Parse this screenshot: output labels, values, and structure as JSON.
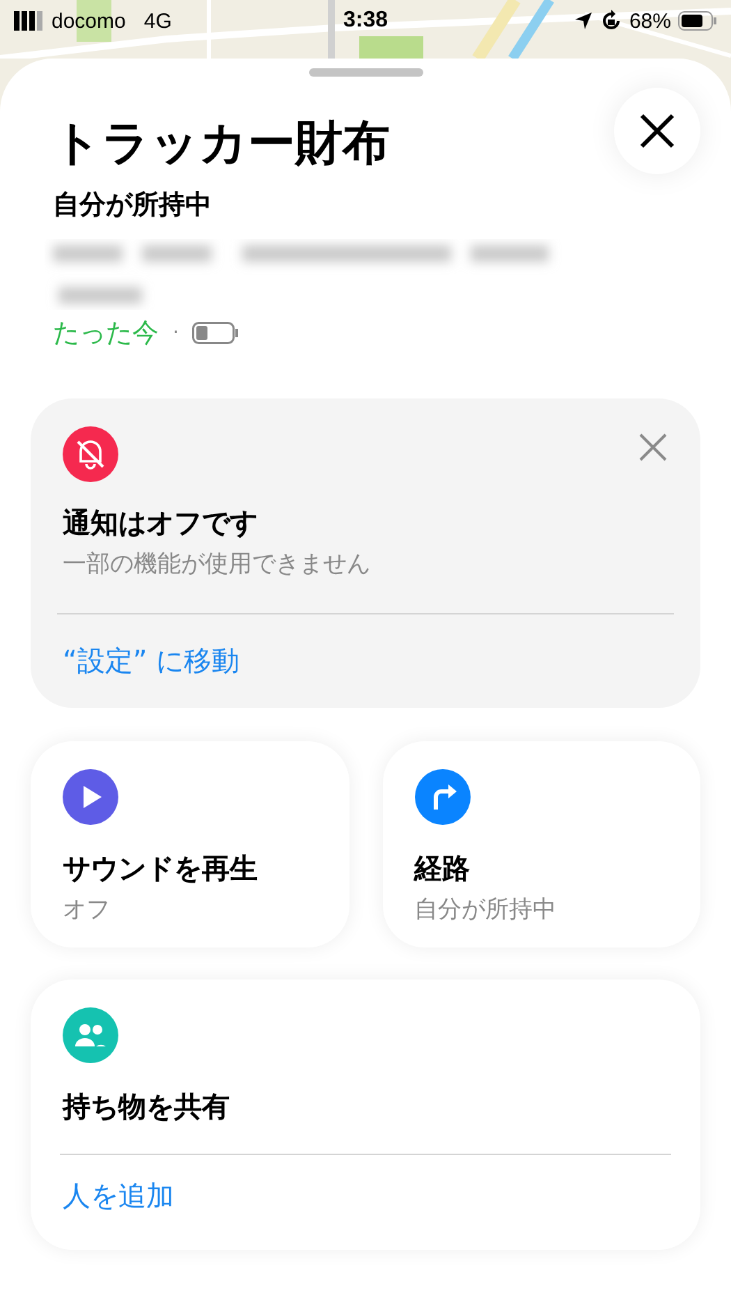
{
  "status_bar": {
    "carrier": "docomo",
    "network": "4G",
    "time": "3:38",
    "battery": "68%"
  },
  "sheet": {
    "title": "トラッカー財布",
    "owner": "自分が所持中",
    "updated": "たった今",
    "separator": "·"
  },
  "notice": {
    "title": "通知はオフです",
    "subtitle": "一部の機能が使用できません",
    "link": "“設定” に移動"
  },
  "actions": [
    {
      "kind": "sound",
      "title": "サウンドを再生",
      "subtitle": "オフ",
      "color": "#5e5ce6"
    },
    {
      "kind": "directions",
      "title": "経路",
      "subtitle": "自分が所持中",
      "color": "#0a84ff"
    }
  ],
  "share": {
    "title": "持ち物を共有",
    "link": "人を追加"
  }
}
